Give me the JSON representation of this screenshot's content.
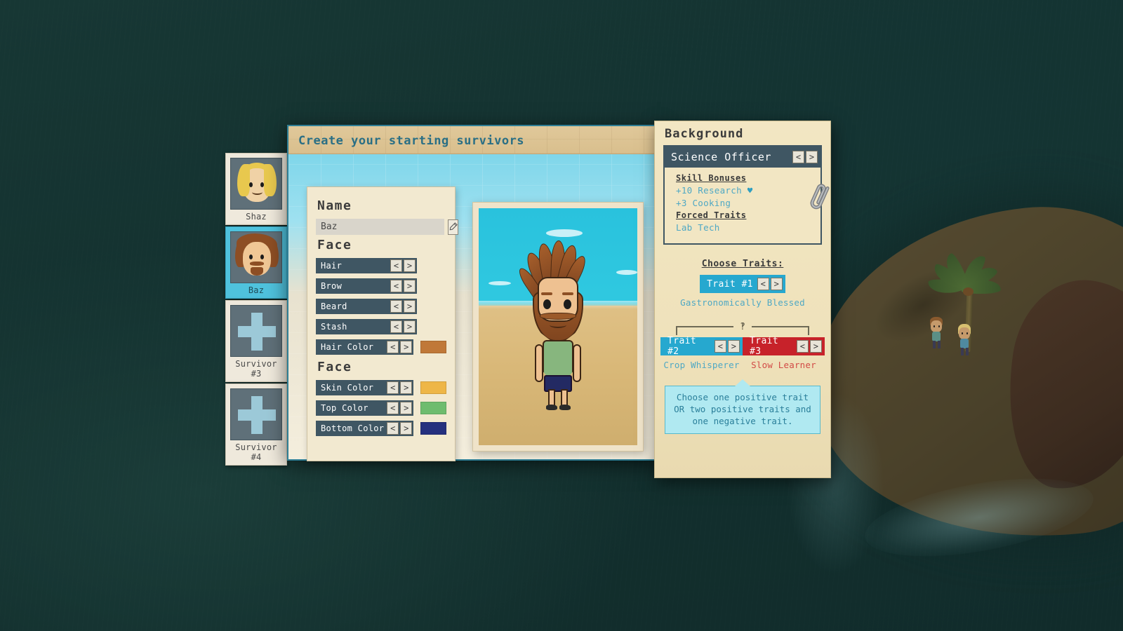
{
  "window": {
    "title": "Create your starting survivors"
  },
  "survivor_tabs": [
    {
      "label": "Shaz",
      "selected": false,
      "kind": "portrait"
    },
    {
      "label": "Baz",
      "selected": true,
      "kind": "portrait"
    },
    {
      "label": "Survivor #3",
      "selected": false,
      "kind": "empty"
    },
    {
      "label": "Survivor #4",
      "selected": false,
      "kind": "empty"
    }
  ],
  "form": {
    "name_heading": "Name",
    "name_value": "Baz",
    "name_placeholder": "Baz",
    "edit_icon": "pencil-icon",
    "face_heading_1": "Face",
    "face_heading_2": "Face",
    "prev_arrow": "<",
    "next_arrow": ">",
    "options_group_1": [
      {
        "label": "Hair",
        "swatch": null
      },
      {
        "label": "Brow",
        "swatch": null
      },
      {
        "label": "Beard",
        "swatch": null
      },
      {
        "label": "Stash",
        "swatch": null
      },
      {
        "label": "Hair Color",
        "swatch": "#c07838"
      }
    ],
    "options_group_2": [
      {
        "label": "Skin Color",
        "swatch": "#eeb647"
      },
      {
        "label": "Top Color",
        "swatch": "#6ebc6e"
      },
      {
        "label": "Bottom Color",
        "swatch": "#25307e"
      }
    ]
  },
  "background_panel": {
    "heading": "Background",
    "selected_background": "Science Officer",
    "prev_arrow": "<",
    "next_arrow": ">",
    "skill_bonuses_heading": "Skill Bonuses",
    "skill_bonuses": [
      {
        "text": "+10 Research",
        "heart": "♥"
      },
      {
        "text": "+3 Cooking",
        "heart": ""
      }
    ],
    "forced_traits_heading": "Forced Traits",
    "forced_traits": [
      "Lab Tech"
    ],
    "paperclip_icon": "paperclip-icon"
  },
  "traits": {
    "heading": "Choose Traits:",
    "link_icon": "link-icon",
    "trait1": {
      "chip": "Trait #1",
      "name": "Gastronomically Blessed",
      "type": "positive"
    },
    "trait2": {
      "chip": "Trait #2",
      "name": "Crop Whisperer",
      "type": "positive"
    },
    "trait3": {
      "chip": "Trait #3",
      "name": "Slow Learner",
      "type": "negative"
    },
    "tooltip": "Choose one positive trait OR two positive traits and one negative trait."
  },
  "colors": {
    "accent_blue": "#26a8cf",
    "negative_red": "#c7222a",
    "panel_dark": "#3f5663",
    "parchment": "#f2e6c3",
    "title_text": "#2a6f85"
  }
}
